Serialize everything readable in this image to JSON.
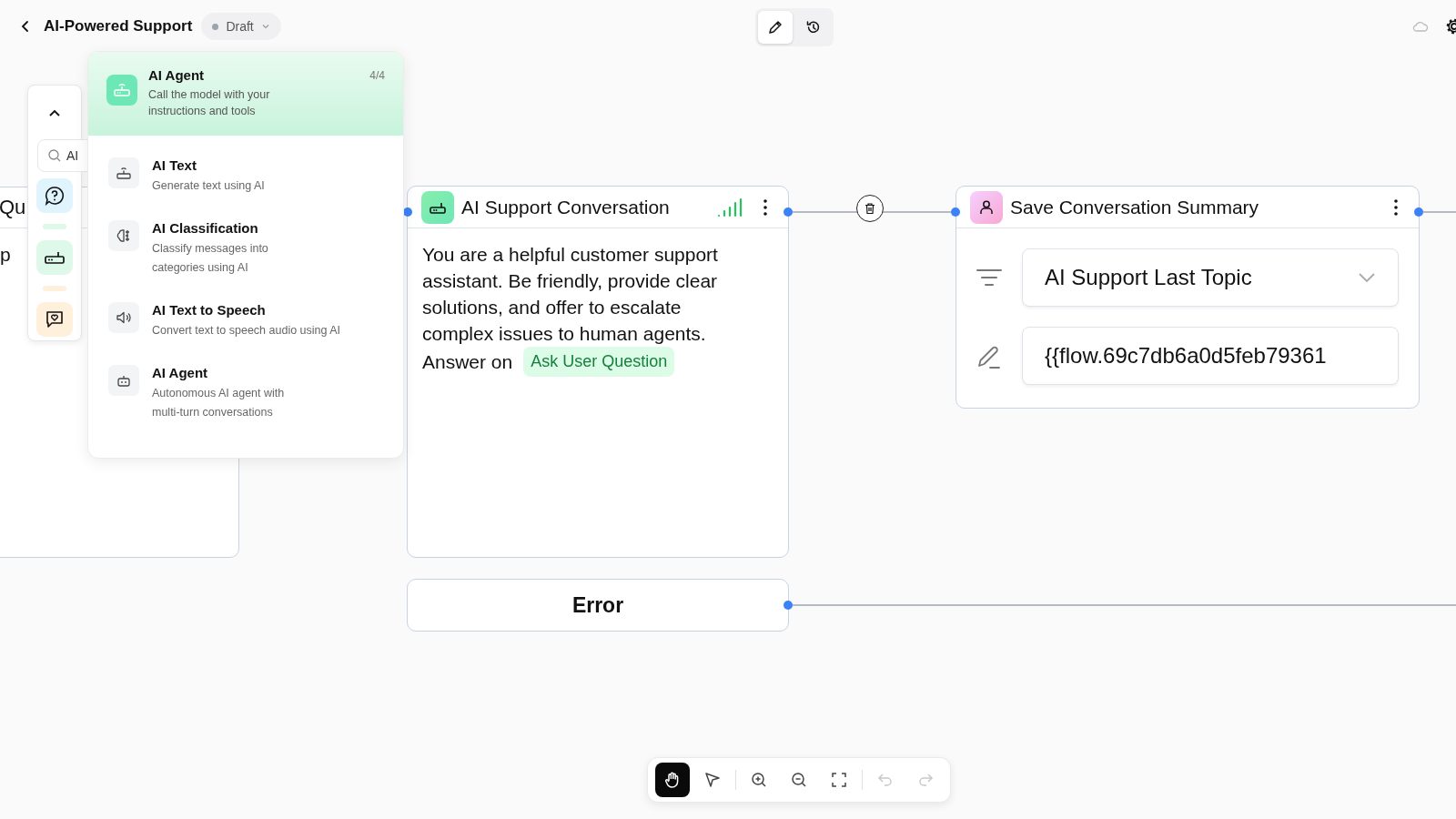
{
  "header": {
    "title": "AI-Powered Support",
    "status": {
      "label": "Draft"
    }
  },
  "top_toolbar": [
    {
      "kind": "edit",
      "selected": true
    },
    {
      "kind": "history",
      "selected": false
    }
  ],
  "sidebar": {
    "search": {
      "value": "AI"
    },
    "categories": [
      {
        "kind": "question",
        "color": "#dff4fd"
      },
      {
        "kind": "router",
        "color": "#def8ea"
      },
      {
        "kind": "chat",
        "color": "#fff0dc"
      }
    ]
  },
  "panel": {
    "featured": {
      "title": "AI Agent",
      "description": "Call the model with your instructions and tools",
      "count": "4/4",
      "selected": true
    },
    "items": [
      {
        "kind": "text",
        "title": "AI Text",
        "description": "Generate text using AI",
        "selected": false
      },
      {
        "kind": "classify",
        "title": "AI Classification",
        "description": "Classify messages into categories using AI",
        "selected": false
      },
      {
        "kind": "speech",
        "title": "AI Text to Speech",
        "description": "Convert text to speech audio using AI",
        "selected": false
      },
      {
        "kind": "agent",
        "title": "AI Agent",
        "description": "Autonomous AI agent with multi-turn conversations",
        "selected": false
      }
    ]
  },
  "partial_node": {
    "title": "Qu",
    "text": "p"
  },
  "conversation_node": {
    "title": "AI Support Conversation",
    "prompt": "You are a helpful customer support assistant. Be friendly, provide clear solutions, and offer to escalate complex issues to human agents.",
    "prompt_end": "Answer on",
    "tag": "Ask User Question"
  },
  "save_node": {
    "title": "Save Conversation Summary",
    "variable": "AI Support Last Topic",
    "value": "{{flow.69c7db6a0d5feb79361"
  },
  "error_node": {
    "label": "Error"
  },
  "bottom_toolbar": {
    "modes": [
      {
        "kind": "hand",
        "selected": true
      },
      {
        "kind": "pointer",
        "selected": false
      }
    ],
    "view": [
      {
        "kind": "zoom-in"
      },
      {
        "kind": "zoom-out"
      },
      {
        "kind": "fit"
      }
    ],
    "history": [
      {
        "kind": "undo",
        "disabled": true
      },
      {
        "kind": "redo",
        "disabled": true
      }
    ]
  }
}
